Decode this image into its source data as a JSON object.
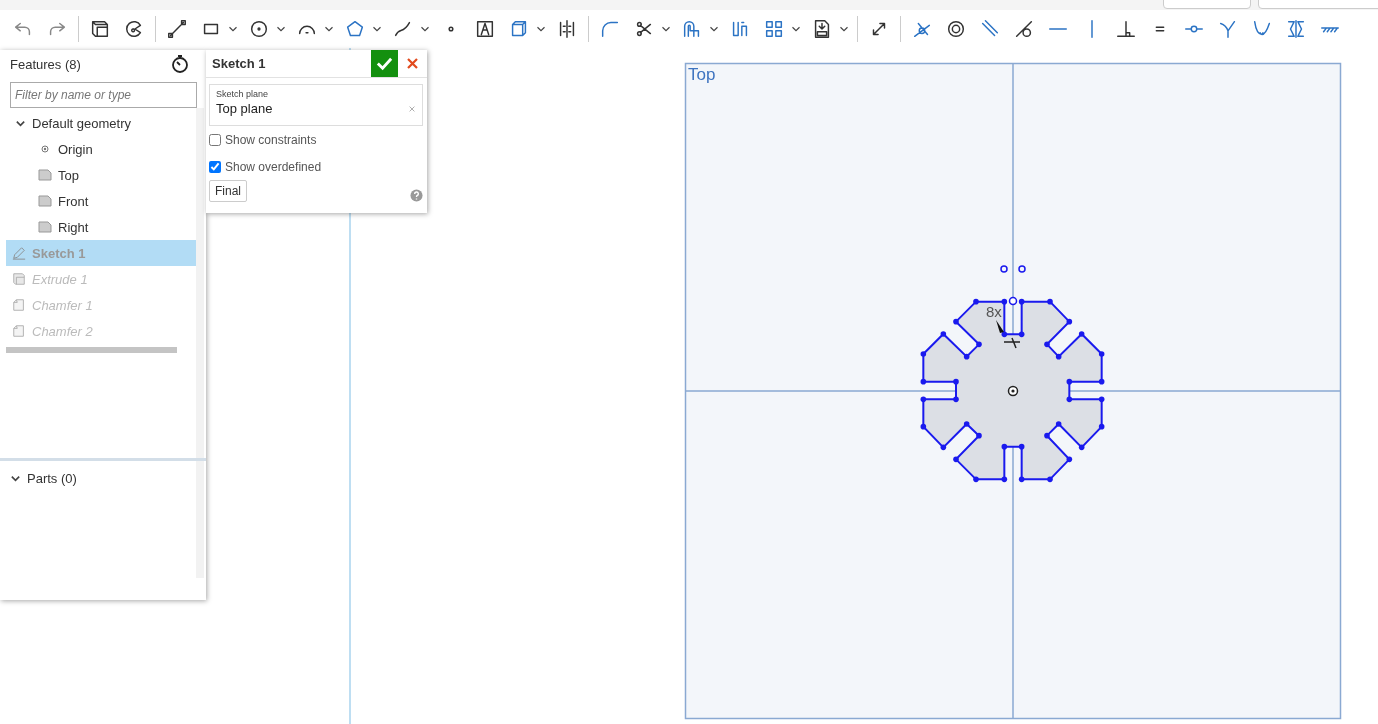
{
  "features_panel": {
    "title": "Features (8)",
    "filter": {
      "placeholder": "Filter by name or type"
    },
    "tree": [
      {
        "label": "Default geometry",
        "expanded": true,
        "children": [
          {
            "label": "Origin",
            "kind": "point"
          },
          {
            "label": "Top",
            "kind": "plane"
          },
          {
            "label": "Front",
            "kind": "plane"
          },
          {
            "label": "Right",
            "kind": "plane"
          }
        ]
      }
    ],
    "features": [
      {
        "label": "Sketch 1",
        "kind": "sketch",
        "selected": true,
        "rolled_back": false
      },
      {
        "label": "Extrude 1",
        "kind": "extrude",
        "selected": false,
        "rolled_back": true
      },
      {
        "label": "Chamfer 1",
        "kind": "chamfer",
        "selected": false,
        "rolled_back": true
      },
      {
        "label": "Chamfer 2",
        "kind": "chamfer",
        "selected": false,
        "rolled_back": true
      }
    ],
    "parts": {
      "title": "Parts (0)",
      "expanded": true
    }
  },
  "sketch_dialog": {
    "title": "Sketch 1",
    "plane_field": {
      "label": "Sketch plane",
      "value": "Top plane"
    },
    "options": [
      {
        "label": "Show constraints",
        "checked": false
      },
      {
        "label": "Show overdefined",
        "checked": true
      }
    ],
    "final_button": "Final"
  },
  "viewport": {
    "plane_label": "Top",
    "constraint_label": "8x"
  }
}
